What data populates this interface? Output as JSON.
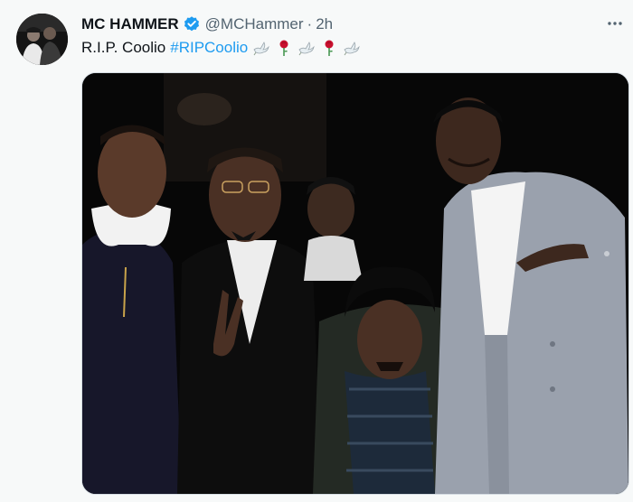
{
  "tweet": {
    "display_name": "MC HAMMER",
    "handle": "@MCHammer",
    "separator": "·",
    "time": "2h",
    "text": "R.I.P. Coolio",
    "hashtag": "#RIPCoolio",
    "emojis": [
      "dove-icon",
      "rose-icon",
      "dove-icon",
      "rose-icon",
      "dove-icon"
    ]
  },
  "colors": {
    "accent": "#1d9bf0",
    "text": "#0f1419",
    "muted": "#536471",
    "background": "#f7f9f9"
  }
}
